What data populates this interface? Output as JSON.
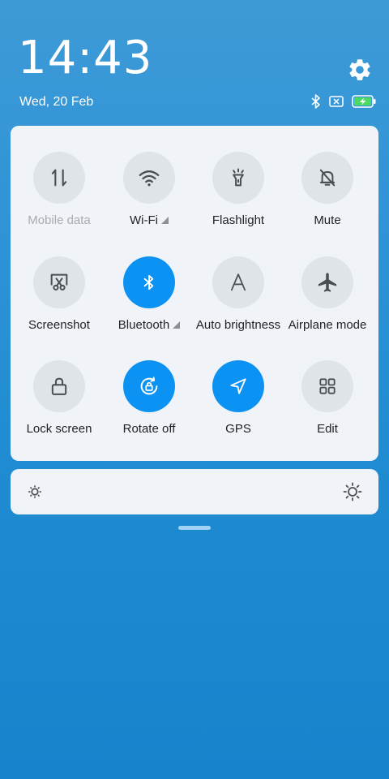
{
  "status": {
    "time": "14:43",
    "date": "Wed, 20 Feb"
  },
  "icons": {
    "settings": "gear-icon",
    "bluetooth_status": "bluetooth-icon",
    "sim_status": "no-sim-icon",
    "battery": "battery-charging-icon"
  },
  "colors": {
    "accent": "#0c92f3",
    "tile_inactive": "#dfe4e9",
    "panel": "#f0f4f8"
  },
  "tiles": [
    {
      "label": "Mobile data",
      "icon": "mobile-data-icon",
      "active": false,
      "disabled": true
    },
    {
      "label": "Wi-Fi",
      "icon": "wifi-icon",
      "active": false,
      "expandable": true
    },
    {
      "label": "Flashlight",
      "icon": "flashlight-icon",
      "active": false
    },
    {
      "label": "Mute",
      "icon": "bell-off-icon",
      "active": false
    },
    {
      "label": "Screenshot",
      "icon": "screenshot-icon",
      "active": false
    },
    {
      "label": "Bluetooth",
      "icon": "bluetooth-icon",
      "active": true,
      "expandable": true
    },
    {
      "label": "Auto brightness",
      "icon": "auto-brightness-icon",
      "active": false
    },
    {
      "label": "Airplane mode",
      "icon": "airplane-icon",
      "active": false
    },
    {
      "label": "Lock screen",
      "icon": "lock-icon",
      "active": false
    },
    {
      "label": "Rotate off",
      "icon": "rotate-lock-icon",
      "active": true
    },
    {
      "label": "GPS",
      "icon": "gps-icon",
      "active": true
    },
    {
      "label": "Edit",
      "icon": "grid-icon",
      "active": false
    }
  ],
  "brightness": {
    "min_icon": "brightness-low-icon",
    "max_icon": "brightness-high-icon"
  }
}
